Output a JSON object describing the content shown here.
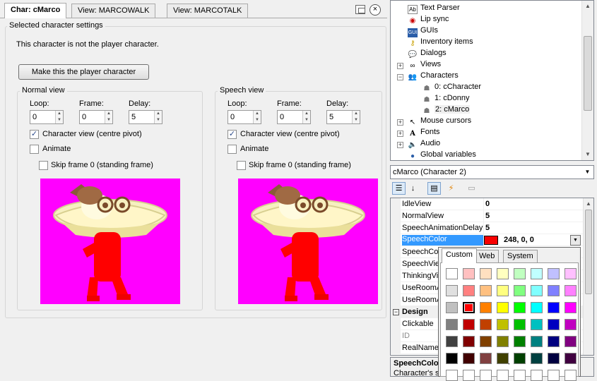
{
  "tabs": [
    {
      "label": "Char: cMarco",
      "active": true
    },
    {
      "label": "View: MARCOWALK",
      "active": false
    },
    {
      "label": "View: MARCOTALK",
      "active": false
    }
  ],
  "settings": {
    "group_title": "Selected character settings",
    "status": "This character is not the player character.",
    "make_player_button": "Make this the player character"
  },
  "normal_view": {
    "title": "Normal view",
    "loop_label": "Loop:",
    "loop_value": "0",
    "frame_label": "Frame:",
    "frame_value": "0",
    "delay_label": "Delay:",
    "delay_value": "5",
    "centre_pivot_label": "Character view (centre pivot)",
    "centre_pivot_checked": true,
    "animate_label": "Animate",
    "animate_checked": false,
    "skip_frame_label": "Skip frame 0 (standing frame)",
    "skip_frame_checked": false
  },
  "speech_view": {
    "title": "Speech view",
    "loop_label": "Loop:",
    "loop_value": "0",
    "frame_label": "Frame:",
    "frame_value": "0",
    "delay_label": "Delay:",
    "delay_value": "5",
    "centre_pivot_label": "Character view (centre pivot)",
    "centre_pivot_checked": true,
    "animate_label": "Animate",
    "animate_checked": false,
    "skip_frame_label": "Skip frame 0 (standing frame)",
    "skip_frame_checked": false
  },
  "tree": {
    "items": [
      {
        "label": "Text Parser",
        "icon": "text-parser-icon"
      },
      {
        "label": "Lip sync",
        "icon": "lips-icon"
      },
      {
        "label": "GUIs",
        "icon": "gui-icon"
      },
      {
        "label": "Inventory items",
        "icon": "key-icon"
      },
      {
        "label": "Dialogs",
        "icon": "speech-bubble-icon"
      },
      {
        "label": "Views",
        "icon": "glasses-icon"
      },
      {
        "label": "Characters",
        "icon": "people-icon"
      },
      {
        "label": "0: cCharacter",
        "icon": "person-icon"
      },
      {
        "label": "1: cDonny",
        "icon": "person-icon"
      },
      {
        "label": "2: cMarco",
        "icon": "person-icon"
      },
      {
        "label": "Mouse cursors",
        "icon": "cursor-icon"
      },
      {
        "label": "Fonts",
        "icon": "font-icon"
      },
      {
        "label": "Audio",
        "icon": "speaker-icon"
      },
      {
        "label": "Global variables",
        "icon": "globe-icon"
      }
    ]
  },
  "object_combo": "cMarco (Character 2)",
  "properties": [
    {
      "name": "IdleView",
      "value": "0"
    },
    {
      "name": "NormalView",
      "value": "5"
    },
    {
      "name": "SpeechAnimationDelay",
      "value": "5"
    },
    {
      "name": "SpeechColor",
      "value": "248, 0, 0"
    },
    {
      "name": "SpeechColorProperty",
      "value": ""
    },
    {
      "name": "SpeechView",
      "value": ""
    },
    {
      "name": "ThinkingView",
      "value": ""
    },
    {
      "name": "UseRoomAreaLighting",
      "value": ""
    },
    {
      "name": "UseRoomAreaScaling",
      "value": ""
    },
    {
      "name": "Design",
      "value": ""
    },
    {
      "name": "Clickable",
      "value": ""
    },
    {
      "name": "ID",
      "value": ""
    },
    {
      "name": "RealName",
      "value": ""
    }
  ],
  "description": {
    "title": "SpeechColor",
    "text": "Character's s"
  },
  "picker": {
    "tabs": [
      "Custom",
      "Web",
      "System"
    ],
    "swatches": [
      [
        "#ffffff",
        "#ffc0c0",
        "#ffe0c0",
        "#ffffc0",
        "#c0ffc0",
        "#c0ffff",
        "#c0c0ff",
        "#ffc0ff"
      ],
      [
        "#e0e0e0",
        "#ff8080",
        "#ffc080",
        "#ffff80",
        "#80ff80",
        "#80ffff",
        "#8080ff",
        "#ff80ff"
      ],
      [
        "#c0c0c0",
        "#ff0000",
        "#ff8000",
        "#ffff00",
        "#00ff00",
        "#00ffff",
        "#0000ff",
        "#ff00ff"
      ],
      [
        "#808080",
        "#c00000",
        "#c04000",
        "#c0c000",
        "#00c000",
        "#00c0c0",
        "#0000c0",
        "#c000c0"
      ],
      [
        "#404040",
        "#800000",
        "#804000",
        "#808000",
        "#008000",
        "#008080",
        "#000080",
        "#800080"
      ],
      [
        "#000000",
        "#400000",
        "#804040",
        "#404000",
        "#004000",
        "#004040",
        "#000040",
        "#400040"
      ],
      [
        "#ffffff",
        "#ffffff",
        "#ffffff",
        "#ffffff",
        "#ffffff",
        "#ffffff",
        "#ffffff",
        "#ffffff"
      ]
    ],
    "selected": "#ff0000"
  },
  "colors": {
    "speech_color": "#f80000",
    "selection": "#3399ff",
    "sprite_bg": "#ff00ff"
  }
}
